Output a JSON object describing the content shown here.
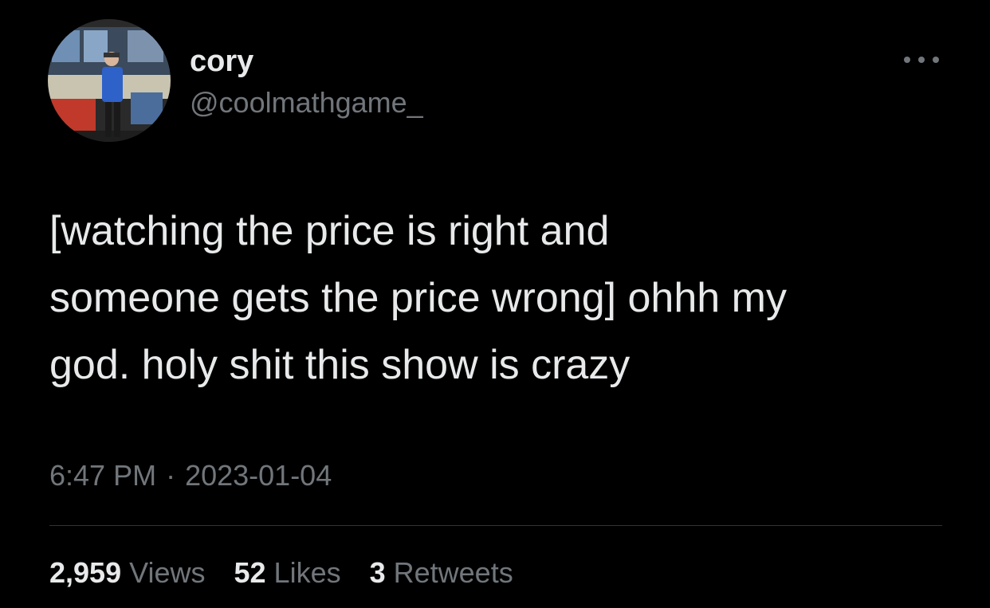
{
  "user": {
    "display_name": "cory",
    "handle": "@coolmathgame_"
  },
  "tweet": {
    "text": "[watching the price is right and\nsomeone gets the price wrong] ohhh my\ngod. holy shit this show is crazy",
    "time": "6:47 PM",
    "separator": "·",
    "date": "2023-01-04"
  },
  "stats": {
    "views_count": "2,959",
    "views_label": "Views",
    "likes_count": "52",
    "likes_label": "Likes",
    "retweets_count": "3",
    "retweets_label": "Retweets"
  },
  "icons": {
    "more": "more-horizontal-icon"
  },
  "colors": {
    "background": "#000000",
    "primary_text": "#e7e9ea",
    "secondary_text": "#71767b",
    "divider": "#2f3336"
  }
}
